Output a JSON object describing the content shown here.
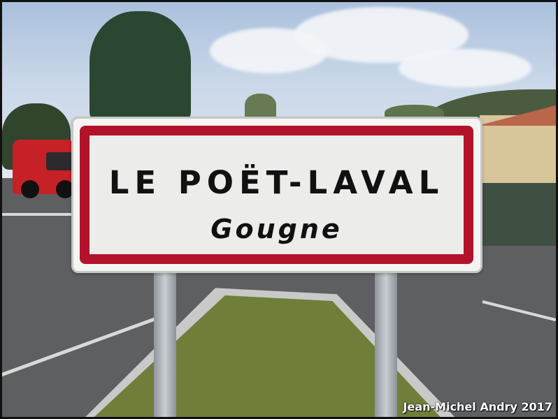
{
  "sign": {
    "town_name": "LE POËT-LAVAL",
    "subtitle": "Gougne",
    "border_color": "#b3132a",
    "background_color": "#ececea"
  },
  "photo_credit": "Jean-Michel Andry 2017"
}
